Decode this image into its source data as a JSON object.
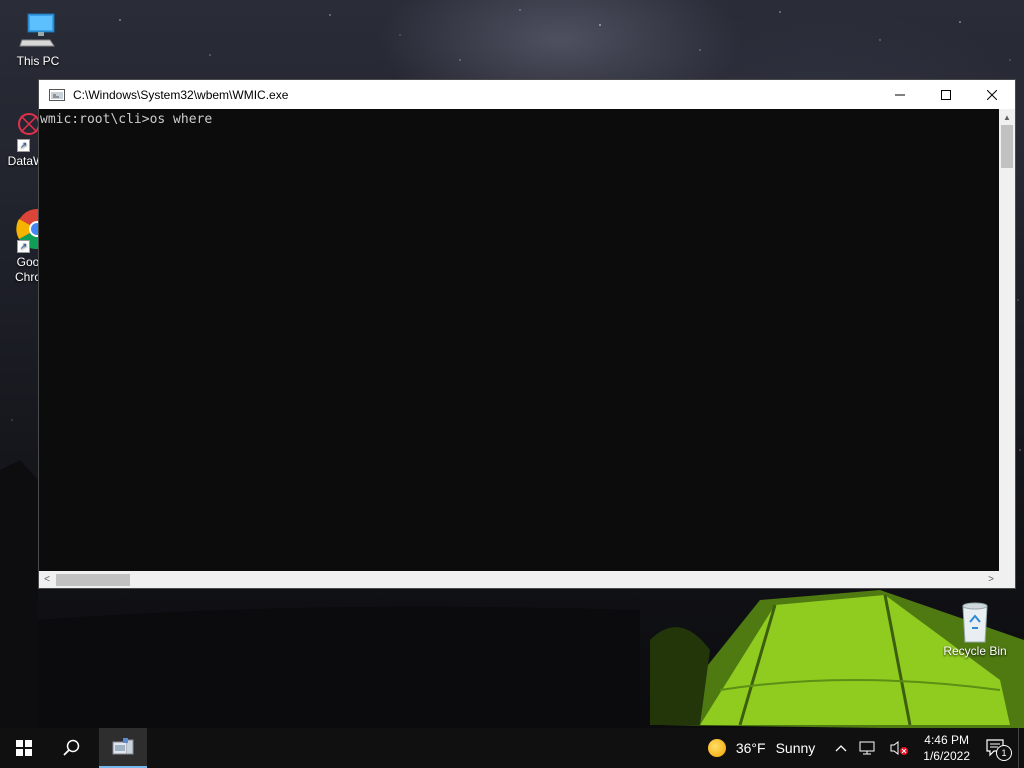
{
  "desktop": {
    "icons": [
      {
        "label": "This PC"
      },
      {
        "label": "DataW"
      },
      {
        "label": "Goo\nChro"
      },
      {
        "label": "Recycle Bin"
      }
    ]
  },
  "window": {
    "title": "C:\\Windows\\System32\\wbem\\WMIC.exe",
    "console_text": "wmic:root\\cli>os where"
  },
  "taskbar": {
    "weather_temp": "36°F",
    "weather_text": "Sunny",
    "time": "4:46 PM",
    "date": "1/6/2022",
    "notification_count": "1"
  },
  "colors": {
    "console_bg": "#0c0c0c",
    "console_fg": "#cccccc",
    "taskbar_bg": "#101010",
    "accent": "#76b9ed"
  }
}
